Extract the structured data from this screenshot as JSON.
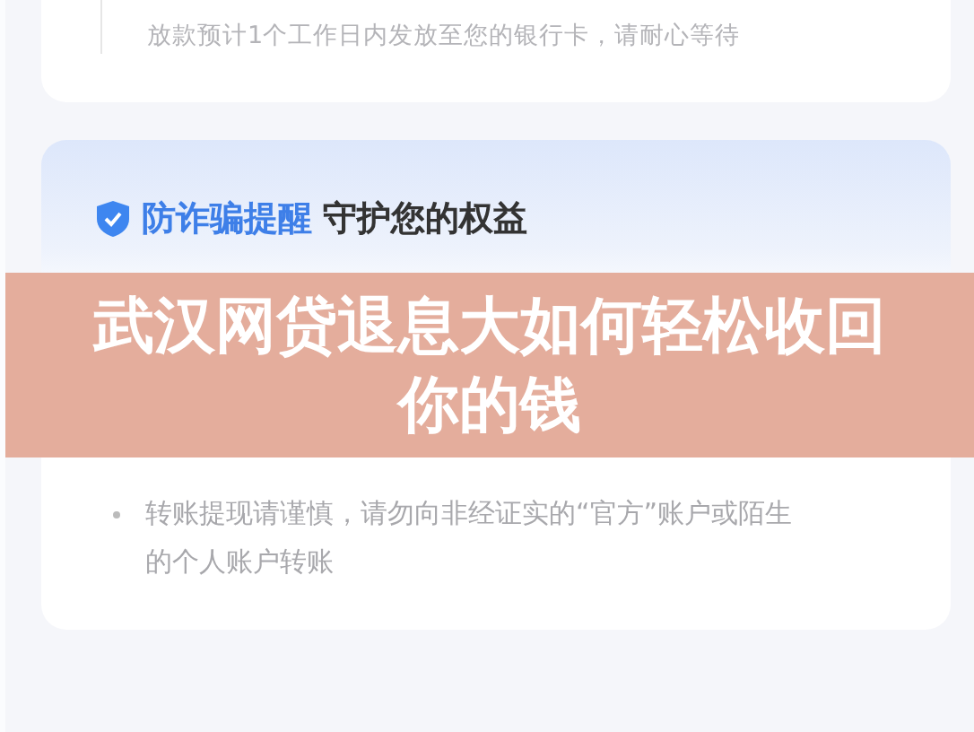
{
  "progress_card": {
    "note": "放款预计1个工作日内发放至您的银行卡，请耐心等待"
  },
  "fraud_card": {
    "title_highlight": "防诈骗提醒",
    "title_rest": "守护您的权益",
    "bullets": [
      "转账提现请谨慎，请勿向非经证实的“官方”账户或陌生的个人账户转账"
    ]
  },
  "banner": {
    "title": "武汉网贷退息大如何轻松收回你的钱"
  }
}
